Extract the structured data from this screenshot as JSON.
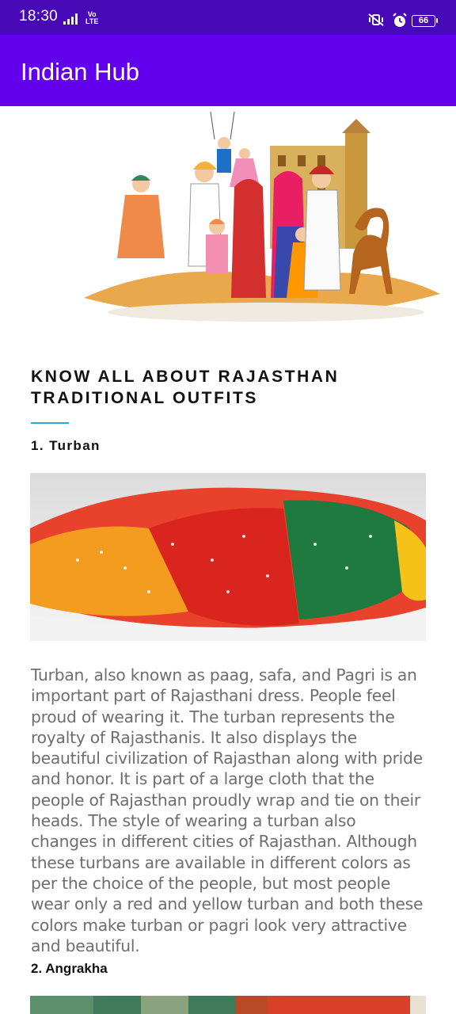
{
  "status_bar": {
    "time": "18:30",
    "network": "Vo\nLTE",
    "battery": "66"
  },
  "app_bar": {
    "title": "Indian Hub"
  },
  "article": {
    "heading": "KNOW ALL ABOUT RAJASTHAN TRADITIONAL OUTFITS",
    "sections": [
      {
        "title": "1. Turban",
        "body": "Turban, also known as paag, safa, and Pagri is an important part of Rajasthani dress. People feel proud of wearing it. The turban represents the royalty of Rajasthanis. It also displays the beautiful civilization of Rajasthan along with pride and honor. It is part of a large cloth that the people of Rajasthan proudly wrap and tie on their heads. The style of wearing a turban also changes in different cities of Rajasthan. Although these turbans are available in different colors as per the choice of the people, but most people wear only a red and yellow turban and both these colors make turban or pagri look very attractive and beautiful."
      },
      {
        "title": "2. Angrakha"
      }
    ]
  },
  "colors": {
    "status_bar": "#4709b6",
    "app_bar": "#6200ee",
    "accent_underline": "#29a8e0"
  }
}
